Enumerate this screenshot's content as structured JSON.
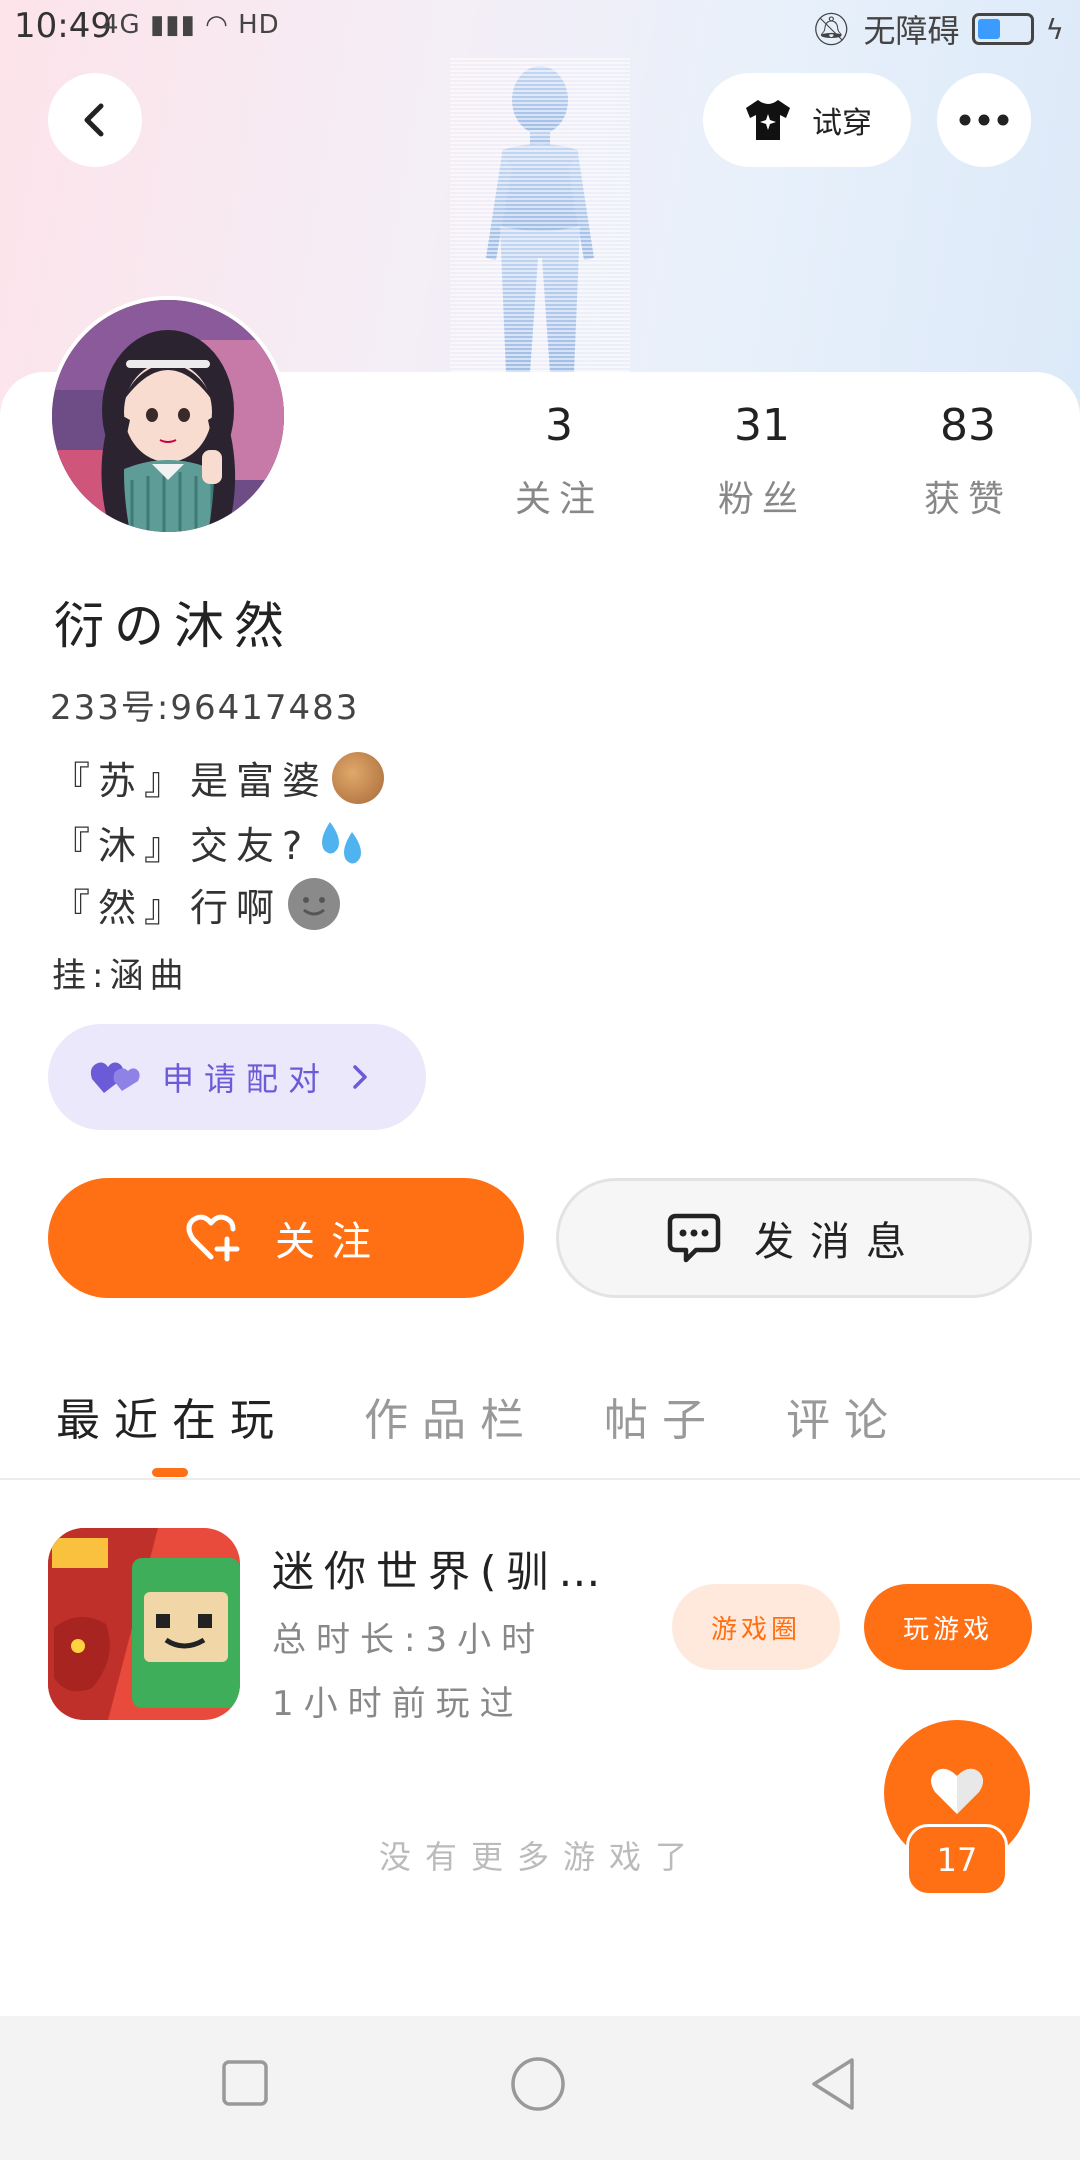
{
  "status_bar": {
    "time": "10:49",
    "signal": "4G",
    "accessibility": "无障碍"
  },
  "header": {
    "try_on_label": "试穿"
  },
  "profile": {
    "stats": [
      {
        "value": "3",
        "label": "关注"
      },
      {
        "value": "31",
        "label": "粉丝"
      },
      {
        "value": "83",
        "label": "获赞"
      }
    ],
    "nickname": "衍の沐然",
    "uid": "233号:96417483",
    "bio_lines": [
      "『苏』是富婆",
      "『沐』交友?",
      "『然』行啊"
    ],
    "hang_line": "挂:涵曲",
    "pair_label": "申请配对"
  },
  "actions": {
    "follow_label": "关注",
    "message_label": "发消息"
  },
  "tabs": [
    {
      "label": "最近在玩",
      "active": true
    },
    {
      "label": "作品栏",
      "active": false
    },
    {
      "label": "帖子",
      "active": false
    },
    {
      "label": "评论",
      "active": false
    }
  ],
  "recent_game": {
    "title": "迷你世界(驯…",
    "total_time": "总时长:3小时",
    "last_played": "1小时前玩过",
    "circle_button": "游戏圈",
    "play_button": "玩游戏"
  },
  "like_count": "17",
  "no_more_text": "没有更多游戏了",
  "colors": {
    "accent": "#ff6f14",
    "pair_bg": "#ece8fb",
    "pair_text": "#6b5bd6"
  }
}
